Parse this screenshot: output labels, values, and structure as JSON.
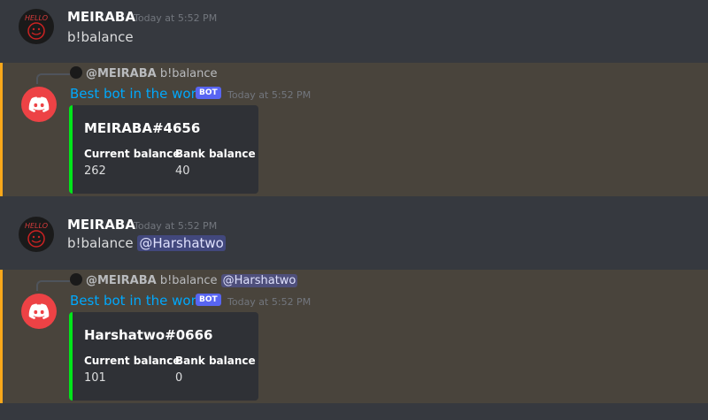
{
  "messages": [
    {
      "author": "MEIRABA",
      "timestamp": "Today at 5:52 PM",
      "content": "b!balance",
      "avatar_text": "HELLO"
    },
    {
      "reply": {
        "author": "@MEIRABA",
        "content": "b!balance"
      },
      "author": "Best bot in the world",
      "badge": "BOT",
      "timestamp": "Today at 5:52 PM",
      "embed": {
        "title": "MEIRABA#4656",
        "fields": [
          {
            "name": "Current balance",
            "value": "262"
          },
          {
            "name": "Bank balance",
            "value": "40"
          }
        ]
      }
    },
    {
      "author": "MEIRABA",
      "timestamp": "Today at 5:52 PM",
      "content": "b!balance",
      "mention": "@Harshatwo",
      "avatar_text": "HELLO"
    },
    {
      "reply": {
        "author": "@MEIRABA",
        "content": "b!balance",
        "mention": "@Harshatwo"
      },
      "author": "Best bot in the world",
      "badge": "BOT",
      "timestamp": "Today at 5:52 PM",
      "embed": {
        "title": "Harshatwo#0666",
        "fields": [
          {
            "name": "Current balance",
            "value": "101"
          },
          {
            "name": "Bank balance",
            "value": "0"
          }
        ]
      }
    }
  ],
  "colors": {
    "background": "#36393f",
    "highlight": "#49443c",
    "highlight_border": "#faa81a",
    "bot_name": "#00a8fc",
    "embed_accent": "#00e51a",
    "bot_avatar": "#ed4245"
  },
  "icons": {
    "bot_avatar": "discord-logo-icon",
    "user_avatar": "hello-face-avatar"
  }
}
